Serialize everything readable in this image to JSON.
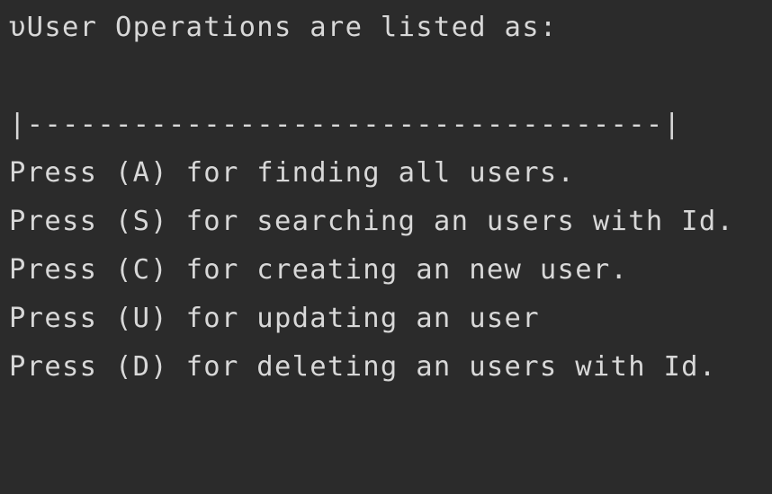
{
  "console": {
    "lines": [
      "υUser Operations are listed as:",
      "",
      "|------------------------------------|",
      "Press (A) for finding all users.",
      "Press (S) for searching an users with Id.",
      "Press (C) for creating an new user.",
      "Press (U) for updating an user",
      "Press (D) for deleting an users with Id."
    ]
  },
  "colors": {
    "background": "#2b2b2b",
    "text": "#d8d8d8"
  }
}
